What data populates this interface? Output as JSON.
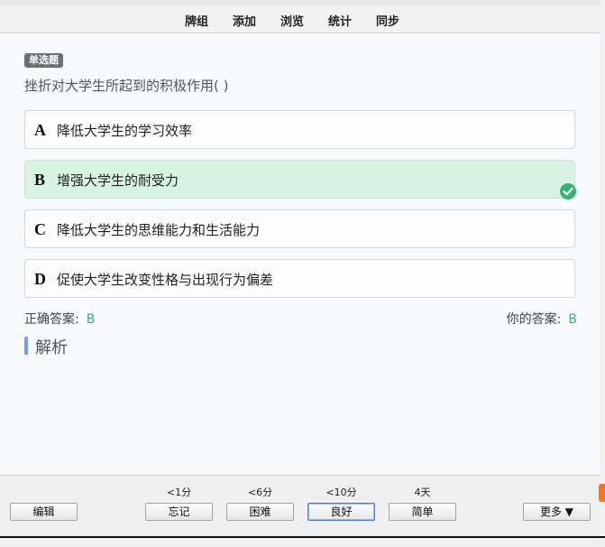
{
  "toolbar": {
    "items": [
      "牌组",
      "添加",
      "浏览",
      "统计",
      "同步"
    ]
  },
  "card": {
    "type_badge": "单选题",
    "question": "挫折对大学生所起到的积极作用( )",
    "options": [
      {
        "letter": "A",
        "text": "降低大学生的学习效率"
      },
      {
        "letter": "B",
        "text": "增强大学生的耐受力"
      },
      {
        "letter": "C",
        "text": "降低大学生的思维能力和生活能力"
      },
      {
        "letter": "D",
        "text": "促使大学生改变性格与出现行为偏差"
      }
    ],
    "correct_label": "正确答案:",
    "correct_value": "B",
    "your_label": "你的答案:",
    "your_value": "B",
    "analysis_label": "解析"
  },
  "bottom": {
    "edit_label": "编辑",
    "more_label": "更多 ▼",
    "answers": [
      {
        "time": "<1分",
        "label": "忘记"
      },
      {
        "time": "<6分",
        "label": "困难"
      },
      {
        "time": "<10分",
        "label": "良好"
      },
      {
        "time": "4天",
        "label": "简单"
      }
    ]
  },
  "colors": {
    "correct_green": "#2eb872",
    "correct_bg": "#d6f3e4",
    "analysis_accent": "#7c9cf0"
  }
}
